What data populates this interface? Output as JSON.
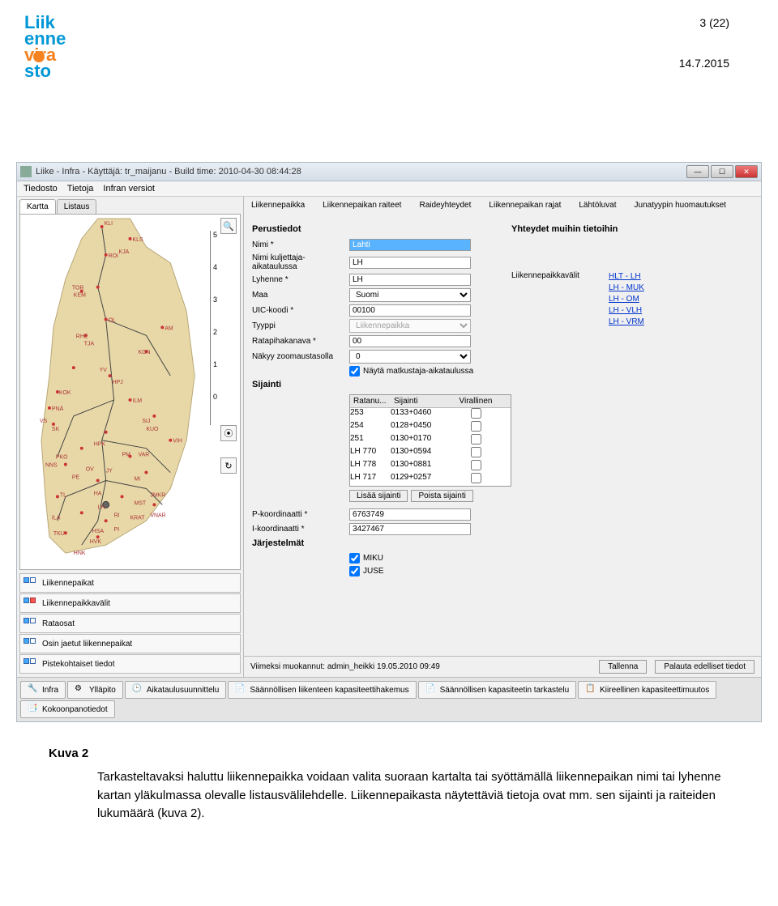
{
  "page": {
    "number": "3 (22)",
    "date": "14.7.2015"
  },
  "logo": {
    "text_top": "Liik",
    "text_mid": "enne",
    "text_bot1": "vira",
    "text_bot2": "sto"
  },
  "window": {
    "title": "Liike - Infra - Käyttäjä: tr_maijanu - Build time: 2010-04-30 08:44:28",
    "menu": [
      "Tiedosto",
      "Tietoja",
      "Infran versiot"
    ]
  },
  "left_tabs": [
    "Kartta",
    "Listaus"
  ],
  "map_scale": [
    "5",
    "4",
    "3",
    "2",
    "1",
    "0"
  ],
  "map_labels": [
    "KLI",
    "KLS",
    "KJA",
    "ROI",
    "TOR",
    "KEM",
    "OL",
    "AM",
    "RHE",
    "TJA",
    "KON",
    "YV",
    "KOK",
    "HPJ",
    "PNÄ",
    "ILM",
    "VS",
    "SIJ",
    "SK",
    "KUO",
    "VIH",
    "HPK",
    "PM",
    "VAR",
    "PKO",
    "NNS",
    "OV",
    "PE",
    "JY",
    "MI",
    "TL",
    "HA",
    "JMKR",
    "LH",
    "MST",
    "RI",
    "KRAT",
    "VNAR",
    "ILA",
    "TKU",
    "HSA",
    "PI",
    "HVK",
    "HNK"
  ],
  "layers": [
    "Liikennepaikat",
    "Liikennepaikkavälit",
    "Rataosat",
    "Osin jaetut liikennepaikat",
    "Pistekohtaiset tiedot"
  ],
  "detail_tabs": [
    "Liikennepaikka",
    "Liikennepaikan raiteet",
    "Raideyhteydet",
    "Liikennepaikan rajat",
    "Lähtöluvat",
    "Junatyypin huomautukset"
  ],
  "form": {
    "section1": "Perustiedot",
    "nimi_label": "Nimi *",
    "nimi": "Lahti",
    "nimikulj_label": "Nimi kuljettaja-aikataulussa",
    "nimikulj": "LH",
    "lyhenne_label": "Lyhenne *",
    "lyhenne": "LH",
    "maa_label": "Maa",
    "maa": "Suomi",
    "uic_label": "UIC-koodi *",
    "uic": "00100",
    "tyyppi_label": "Tyyppi",
    "tyyppi": "Liikennepaikka",
    "ratapiha_label": "Ratapihakanava *",
    "ratapiha": "00",
    "zoom_label": "Näkyy zoomaustasolla",
    "zoom": "0",
    "nayta_label": "Näytä matkustaja-aikataulussa",
    "section2": "Sijainti",
    "loc_headers": [
      "Ratanu...",
      "Sijainti",
      "Virallinen"
    ],
    "loc_rows": [
      {
        "a": "253",
        "b": "0133+0460"
      },
      {
        "a": "254",
        "b": "0128+0450"
      },
      {
        "a": "251",
        "b": "0130+0170"
      },
      {
        "a": "LH 770",
        "b": "0130+0594"
      },
      {
        "a": "LH 778",
        "b": "0130+0881"
      },
      {
        "a": "LH 717",
        "b": "0129+0257"
      }
    ],
    "btn_add": "Lisää sijainti",
    "btn_del": "Poista sijainti",
    "pkoord_label": "P-koordinaatti *",
    "pkoord": "6763749",
    "ikoord_label": "I-koordinaatti *",
    "ikoord": "3427467",
    "section3": "Järjestelmät",
    "sys1": "MIKU",
    "sys2": "JUSE",
    "right_head": "Yhteydet muihin tietoihin",
    "lpv_label": "Liikennepaikkavälit",
    "links": [
      "HLT - LH",
      "LH - MUK",
      "LH - OM",
      "LH - VLH",
      "LH - VRM"
    ]
  },
  "status": {
    "modified": "Viimeksi muokannut: admin_heikki 19.05.2010 09:49",
    "save": "Tallenna",
    "revert": "Palauta edelliset tiedot"
  },
  "bottom_tabs": [
    "Infra",
    "Ylläpito",
    "Aikataulusuunnittelu",
    "Säännöllisen liikenteen kapasiteettihakemus",
    "Säännöllisen kapasiteetin tarkastelu",
    "Kiireellinen kapasiteettimuutos",
    "Kokoonpanotiedot"
  ],
  "caption": "Kuva 2",
  "body_text": "Tarkasteltavaksi haluttu liikennepaikka voidaan valita suoraan kartalta tai syöttämällä liikennepaikan nimi tai lyhenne kartan yläkulmassa olevalle listausvälilehdelle. Liikennepaikasta näytettäviä tietoja ovat mm. sen sijainti ja raiteiden lukumäärä (kuva 2)."
}
